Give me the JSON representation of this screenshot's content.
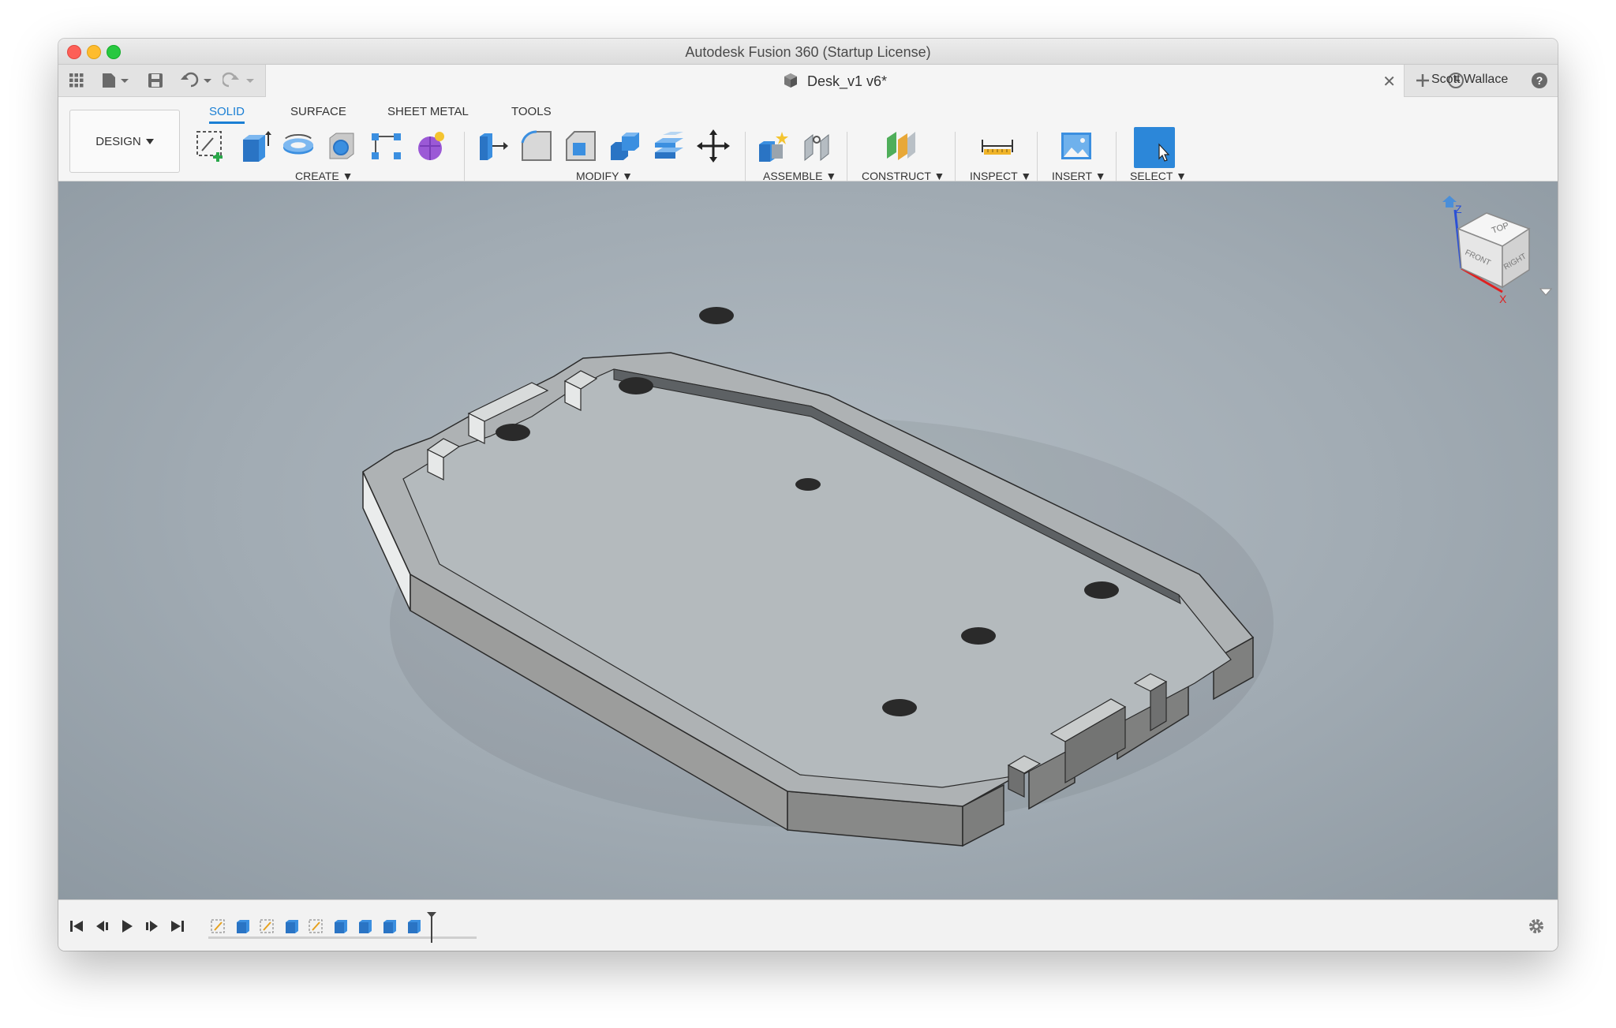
{
  "window": {
    "title": "Autodesk Fusion 360 (Startup License)"
  },
  "document_tab": {
    "name": "Desk_v1 v6*"
  },
  "user": {
    "name": "Scott Wallace"
  },
  "workspace": {
    "label": "DESIGN"
  },
  "tabs": [
    "SOLID",
    "SURFACE",
    "SHEET METAL",
    "TOOLS"
  ],
  "groups": {
    "create": "CREATE",
    "modify": "MODIFY",
    "assemble": "ASSEMBLE",
    "construct": "CONSTRUCT",
    "inspect": "INSPECT",
    "insert": "INSERT",
    "select": "SELECT"
  },
  "viewcube": {
    "top": "TOP",
    "front": "FRONT",
    "right": "RIGHT",
    "axis_z": "Z",
    "axis_x": "X"
  },
  "colors": {
    "accent": "#1a7fd4",
    "viewport": "#a1abb3",
    "select": "#2c87d9"
  },
  "timeline_features": [
    "sketch",
    "extrude",
    "sketch",
    "extrude",
    "sketch",
    "extrude",
    "extrude",
    "extrude",
    "extrude"
  ]
}
